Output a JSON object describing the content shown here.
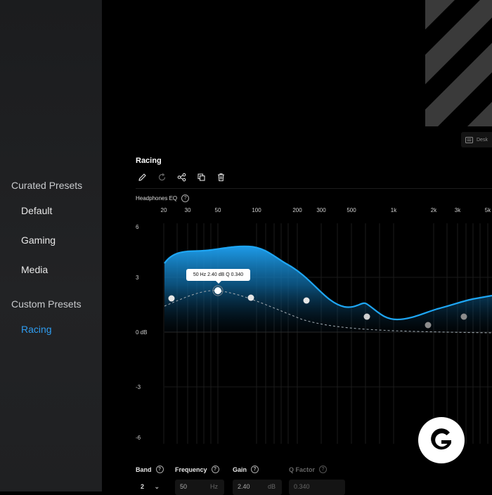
{
  "sidebar": {
    "curated_header": "Curated Presets",
    "curated_items": [
      {
        "label": "Default"
      },
      {
        "label": "Gaming"
      },
      {
        "label": "Media"
      }
    ],
    "custom_header": "Custom Presets",
    "custom_items": [
      {
        "label": "Racing",
        "active": true
      }
    ]
  },
  "top_button": {
    "label": "Desk",
    "icon": "keyboard-icon"
  },
  "preset": {
    "title": "Racing"
  },
  "toolbar": {
    "icons": [
      "pencil-icon",
      "reset-icon",
      "share-icon",
      "duplicate-icon",
      "trash-icon"
    ]
  },
  "eq": {
    "label": "Headphones EQ",
    "freq_ticks": [
      "20",
      "30",
      "50",
      "100",
      "200",
      "300",
      "500",
      "1k",
      "2k",
      "3k",
      "5k"
    ],
    "gain_ticks": [
      "6",
      "3",
      "0 dB",
      "-3",
      "-6"
    ],
    "tooltip": "50 Hz 2.40 dB Q 0.340",
    "accent": "#1e9be8"
  },
  "controls": {
    "band_label": "Band",
    "band_value": "2",
    "frequency_label": "Frequency",
    "frequency_value": "50",
    "frequency_unit": "Hz",
    "gain_label": "Gain",
    "gain_value": "2.40",
    "gain_unit": "dB",
    "q_label": "Q Factor",
    "q_value": "0.340"
  }
}
